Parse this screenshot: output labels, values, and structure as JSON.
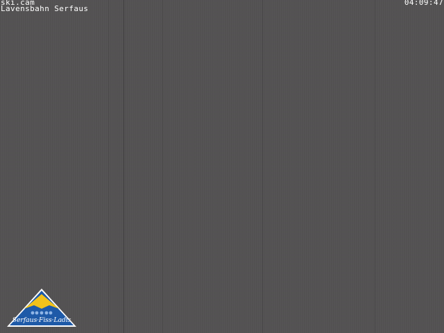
{
  "overlay": {
    "brand": "ski.cam",
    "location": "Lavensbahn Serfaus",
    "timestamp": "04:09:47"
  },
  "logo": {
    "icon": "serfaus-fiss-ladis-mountain-logo",
    "text": "Serfaus·Fiss·Ladis",
    "colors": {
      "triangle": "#1e5aa8",
      "peak": "#f2c21a",
      "stars": "#8fb5e6",
      "text": "#ffffff"
    }
  },
  "scene": {
    "background": "#545353"
  }
}
